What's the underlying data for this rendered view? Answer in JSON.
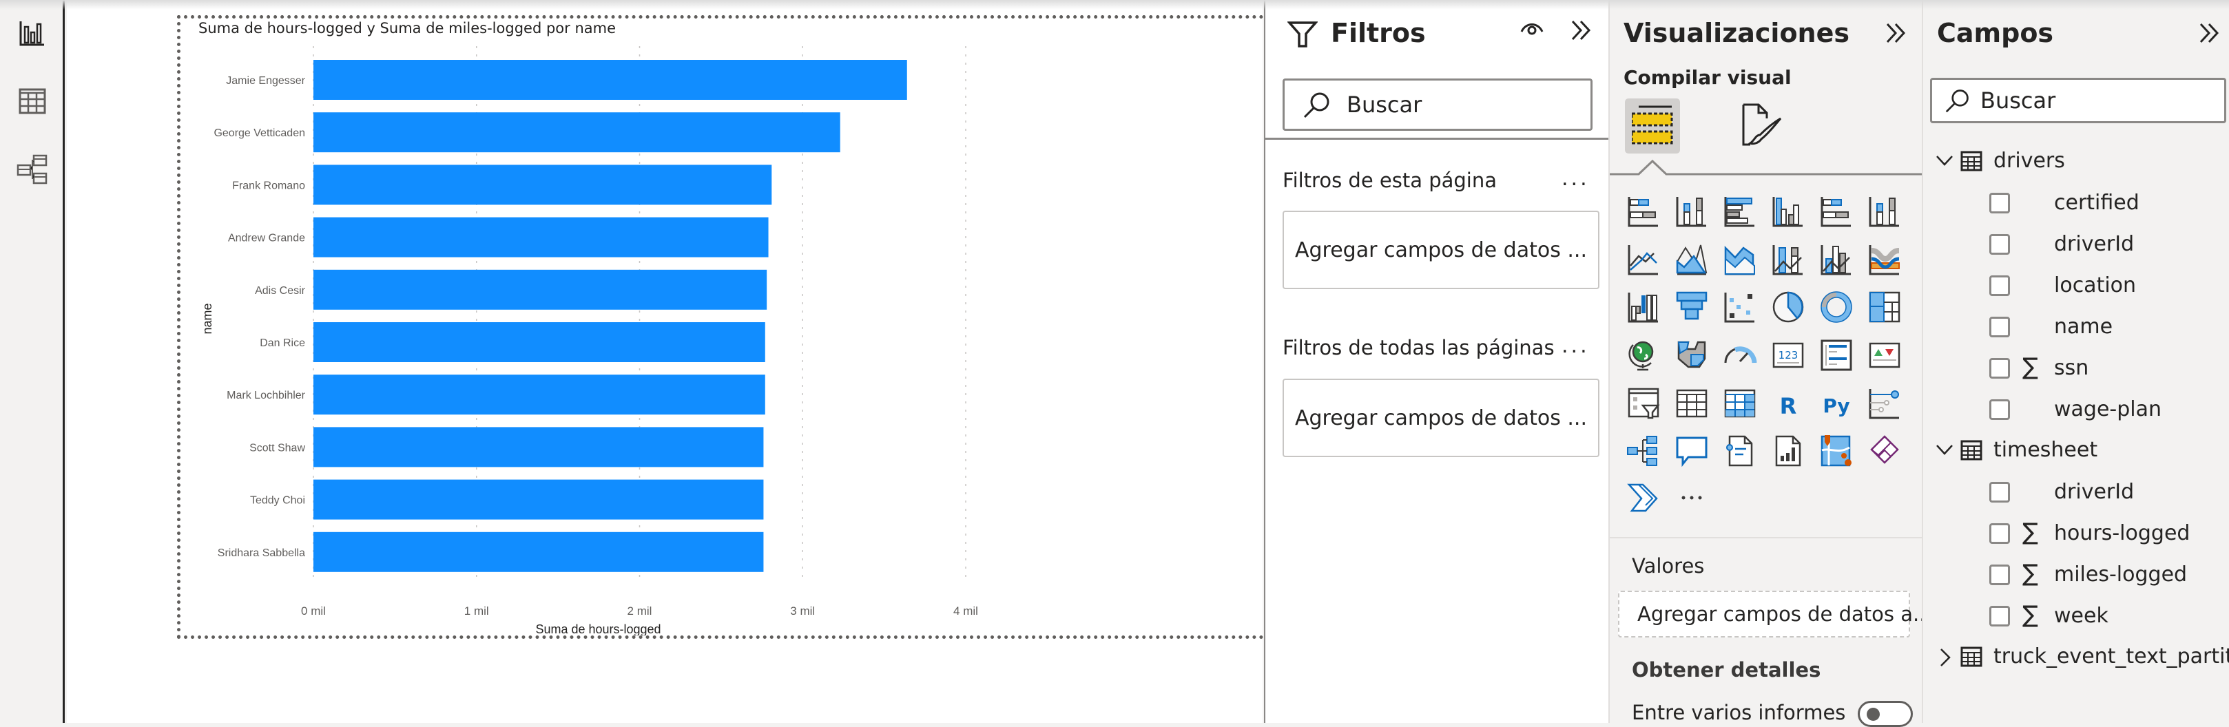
{
  "left_nav": {
    "items": [
      {
        "name": "report-view",
        "icon": "bar-chart-icon",
        "active": true
      },
      {
        "name": "data-view",
        "icon": "table-icon",
        "active": false
      },
      {
        "name": "model-view",
        "icon": "model-icon",
        "active": false
      }
    ]
  },
  "visual": {
    "title": "Suma de hours-logged y Suma de miles-logged por name"
  },
  "chart_data": {
    "type": "bar",
    "orientation": "horizontal",
    "title": "Suma de hours-logged y Suma de miles-logged por name",
    "xlabel": "Suma de hours-logged",
    "ylabel": "name",
    "categories": [
      "Jamie Engesser",
      "George Vetticaden",
      "Frank Romano",
      "Andrew Grande",
      "Adis Cesir",
      "Dan Rice",
      "Mark Lochbihler",
      "Scott Shaw",
      "Teddy Choi",
      "Sridhara Sabbella"
    ],
    "values": [
      3640,
      3230,
      2810,
      2790,
      2780,
      2770,
      2770,
      2760,
      2760,
      2760
    ],
    "xlim": [
      0,
      4000
    ],
    "xticks": [
      0,
      1000,
      2000,
      3000,
      4000
    ],
    "xtick_labels": [
      "0 mil",
      "1 mil",
      "2 mil",
      "3 mil",
      "4 mil"
    ],
    "grid": true,
    "bar_color": "#118dff"
  },
  "filters": {
    "title": "Filtros",
    "search_placeholder": "Buscar",
    "page_section": "Filtros de esta página",
    "page_drop": "Agregar campos de datos ...",
    "all_section": "Filtros de todas las páginas",
    "all_drop": "Agregar campos de datos ...",
    "more": "..."
  },
  "visualizations": {
    "title": "Visualizaciones",
    "build_label": "Compilar visual",
    "values_label": "Valores",
    "values_drop": "Agregar campos de datos a...",
    "drillthrough_label": "Obtener detalles",
    "cross_report_label": "Entre varios informes",
    "cross_report_on": false,
    "more": "...",
    "icons": [
      "stacked-bar-chart-icon",
      "stacked-column-chart-icon",
      "clustered-bar-chart-icon",
      "clustered-column-chart-icon",
      "100-stacked-bar-chart-icon",
      "100-stacked-column-chart-icon",
      "line-chart-icon",
      "area-chart-icon",
      "stacked-area-chart-icon",
      "line-stacked-column-chart-icon",
      "line-clustered-column-chart-icon",
      "ribbon-chart-icon",
      "waterfall-chart-icon",
      "funnel-chart-icon",
      "scatter-chart-icon",
      "pie-chart-icon",
      "donut-chart-icon",
      "treemap-icon",
      "map-icon",
      "filled-map-icon",
      "gauge-icon",
      "card-icon",
      "multi-row-card-icon",
      "kpi-icon",
      "slicer-icon",
      "table-icon",
      "matrix-icon",
      "r-visual-icon",
      "python-visual-icon",
      "key-influencers-icon",
      "decomposition-tree-icon",
      "qa-icon",
      "smart-narrative-icon",
      "paginated-report-icon",
      "azure-map-icon",
      "power-apps-icon",
      "power-automate-icon",
      "more-visuals-icon"
    ]
  },
  "fields": {
    "title": "Campos",
    "search_placeholder": "Buscar",
    "tables": [
      {
        "name": "drivers",
        "expanded": true,
        "fields": [
          {
            "name": "certified",
            "sum": false
          },
          {
            "name": "driverId",
            "sum": false
          },
          {
            "name": "location",
            "sum": false
          },
          {
            "name": "name",
            "sum": false
          },
          {
            "name": "ssn",
            "sum": true
          },
          {
            "name": "wage-plan",
            "sum": false
          }
        ]
      },
      {
        "name": "timesheet",
        "expanded": true,
        "fields": [
          {
            "name": "driverId",
            "sum": false
          },
          {
            "name": "hours-logged",
            "sum": true
          },
          {
            "name": "miles-logged",
            "sum": true
          },
          {
            "name": "week",
            "sum": true
          }
        ]
      },
      {
        "name": "truck_event_text_partiti...",
        "expanded": false,
        "fields": []
      }
    ],
    "sigma": "∑"
  }
}
